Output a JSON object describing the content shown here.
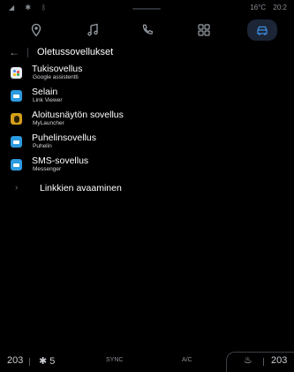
{
  "status": {
    "left_icons": [
      "signal-icon",
      "wifi-icon",
      "bluetooth-icon"
    ],
    "left_glyphs": "◢ ✱ ᛒ",
    "temperature": "16°C",
    "clock": "20:2"
  },
  "nav": {
    "items": [
      "navigation-icon",
      "music-icon",
      "phone-icon",
      "apps-icon",
      "car-icon"
    ],
    "active": "car-icon",
    "accent": "#3d8de0"
  },
  "header": {
    "back_glyph": "←",
    "title": "Oletussovellukset"
  },
  "apps": [
    {
      "title": "Tukisovellus",
      "subtitle": "Google assistentti",
      "icon": "assistant-icon"
    },
    {
      "title": "Selain",
      "subtitle": "Link Viewer",
      "icon": "browser-icon"
    },
    {
      "title": "Aloitusnäytön sovellus",
      "subtitle": "MyLauncher",
      "icon": "launcher-icon"
    },
    {
      "title": "Puhelinsovellus",
      "subtitle": "Puhelin",
      "icon": "phone-app-icon"
    },
    {
      "title": "SMS-sovellus",
      "subtitle": "Messenger",
      "icon": "messenger-icon"
    }
  ],
  "link_row": {
    "chevron": "›",
    "label": "Linkkien avaaminen"
  },
  "climate": {
    "temp_left": "203",
    "fan_glyph": "✱",
    "fan_level": "5",
    "sync": "SYNC",
    "ac": "A/C",
    "seat_glyph": "♨",
    "temp_right": "203"
  }
}
